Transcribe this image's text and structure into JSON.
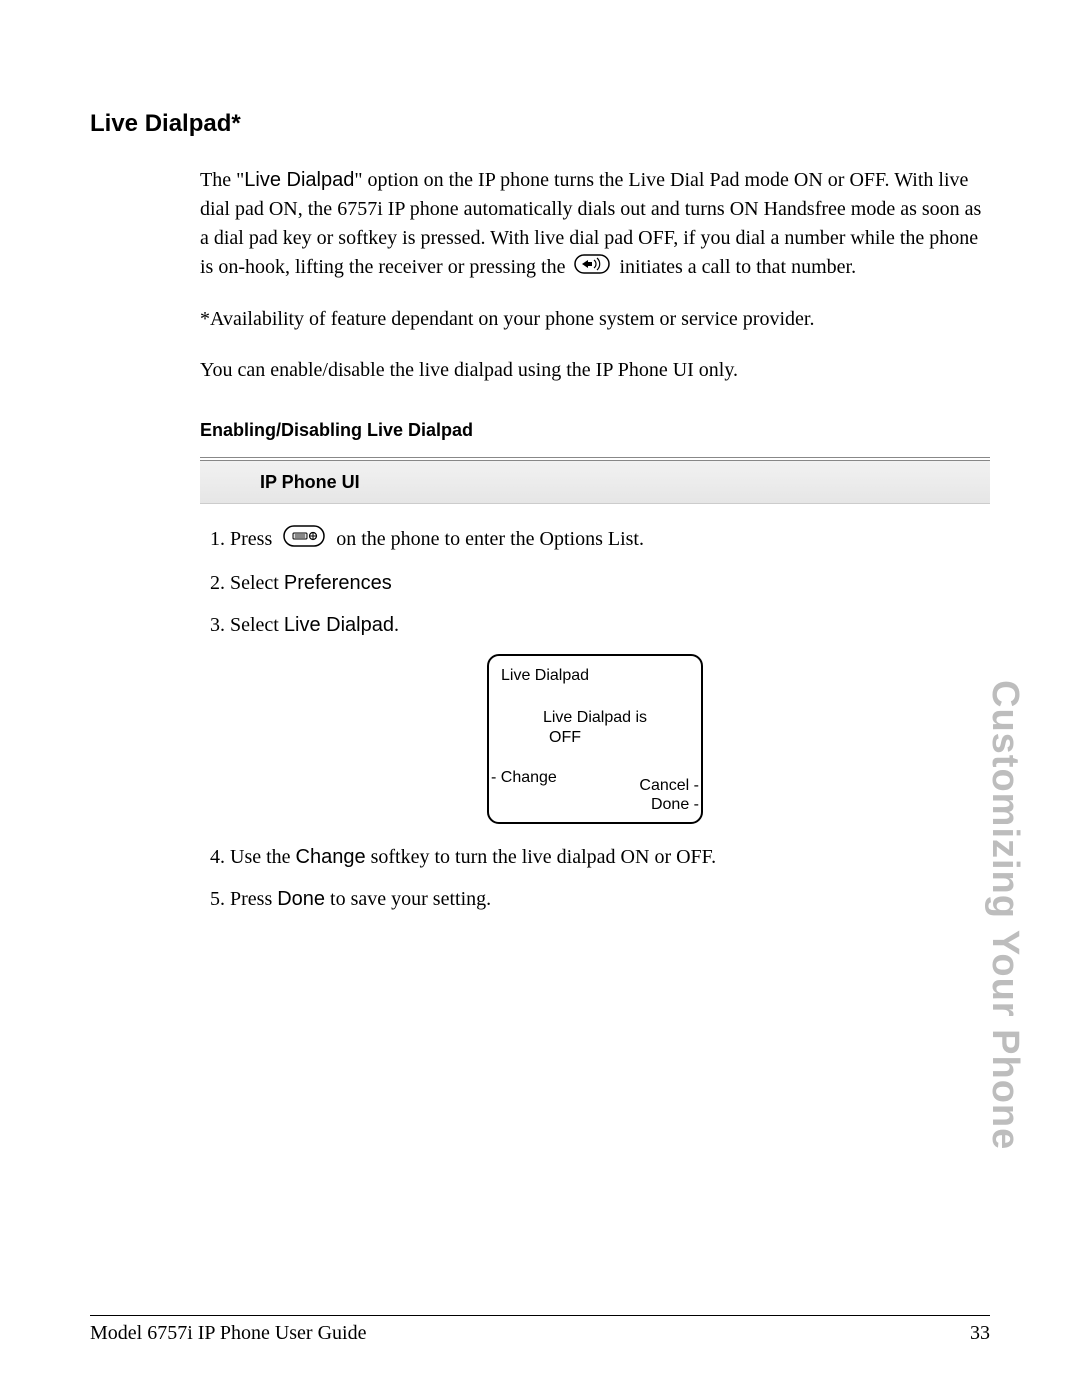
{
  "heading": "Live Dialpad*",
  "intro": {
    "prefix": "The \"",
    "term": "Live Dialpad",
    "after_term": "\" option on the IP phone turns the Live Dial Pad mode ON or OFF. With live dial pad ON, the 6757i IP phone automatically dials out and turns ON Handsfree mode as soon as a dial pad key or softkey is pressed. With live dial pad OFF, if you dial a number while the phone is on-hook, lifting the receiver or pressing the ",
    "after_icon": " initiates a call to that number."
  },
  "footnote": "*Availability of feature dependant on your phone system or service provider.",
  "note": "You can enable/disable the live dialpad using the IP Phone UI only.",
  "subheading": "Enabling/Disabling Live Dialpad",
  "banner": "IP Phone UI",
  "steps": {
    "s1_a": "Press ",
    "s1_b": " on the phone to enter the Options List.",
    "s2_a": "Select ",
    "s2_term": "Preferences",
    "s3_a": "Select ",
    "s3_term": "Live Dialpad",
    "s3_b": ".",
    "s4_a": "Use the ",
    "s4_term": "Change",
    "s4_b": " softkey to turn the live dialpad ON or OFF.",
    "s5_a": "Press ",
    "s5_term": "Done",
    "s5_b": " to save your setting."
  },
  "phone_screen": {
    "title": "Live Dialpad",
    "status_line1": "Live Dialpad is",
    "status_line2": "OFF",
    "change": "- Change",
    "cancel": "Cancel -",
    "done": "Done -"
  },
  "side_label": "Customizing Your Phone",
  "footer_left": "Model 6757i IP Phone User Guide",
  "footer_right": "33"
}
